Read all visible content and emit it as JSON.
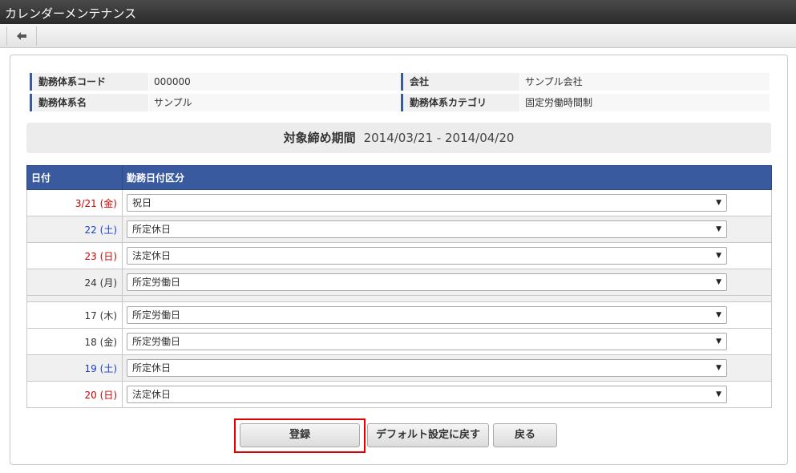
{
  "window": {
    "title": "カレンダーメンテナンス"
  },
  "toolbar": {
    "back_icon": "arrow-left-icon"
  },
  "info": {
    "work_code_label": "勤務体系コード",
    "work_code_value": "000000",
    "company_label": "会社",
    "company_value": "サンプル会社",
    "work_name_label": "勤務体系名",
    "work_name_value": "サンプル",
    "category_label": "勤務体系カテゴリ",
    "category_value": "固定労働時間制"
  },
  "period": {
    "label": "対象締め期間",
    "value": "2014/03/21 - 2014/04/20"
  },
  "grid": {
    "headers": [
      "日付",
      "勤務日付区分"
    ],
    "rows": [
      {
        "date": "3/21 (金)",
        "type": "祝日"
      },
      {
        "date": "22 (土)",
        "type": "所定休日"
      },
      {
        "date": "23 (日)",
        "type": "法定休日"
      },
      {
        "date": "24 (月)",
        "type": "所定労働日"
      },
      {
        "date": "17 (木)",
        "type": "所定労働日"
      },
      {
        "date": "18 (金)",
        "type": "所定労働日"
      },
      {
        "date": "19 (土)",
        "type": "所定休日"
      },
      {
        "date": "20 (日)",
        "type": "法定休日"
      }
    ]
  },
  "buttons": {
    "register": "登録",
    "default": "デフォルト設定に戻す",
    "back": "戻る"
  },
  "colors": {
    "header_blue": "#3a5aa0",
    "holiday_red": "#cc0000",
    "saturday_blue": "#1a3fcc",
    "highlight": "#e00000"
  }
}
